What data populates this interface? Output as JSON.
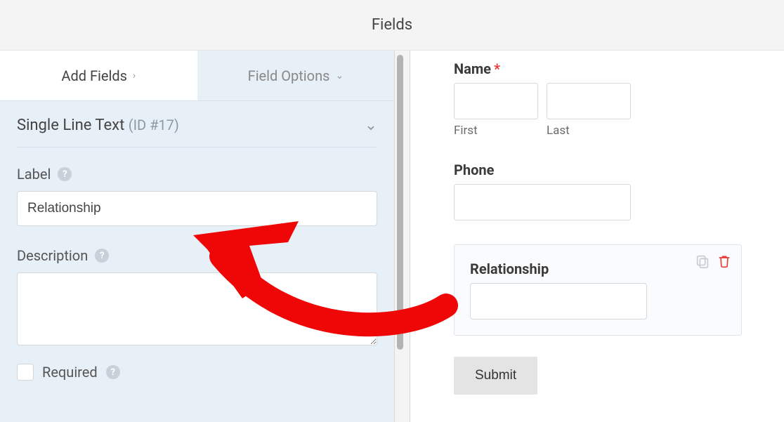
{
  "header": {
    "title": "Fields"
  },
  "tabs": {
    "add_fields": "Add Fields",
    "field_options": "Field Options"
  },
  "editor": {
    "type_label": "Single Line Text",
    "id_label": "(ID #17)",
    "label_label": "Label",
    "label_value": "Relationship",
    "description_label": "Description",
    "description_value": "",
    "required_label": "Required"
  },
  "preview": {
    "name_label": "Name",
    "first_label": "First",
    "last_label": "Last",
    "phone_label": "Phone",
    "relationship_label": "Relationship",
    "submit_label": "Submit"
  },
  "icons": {
    "help": "?",
    "chev_right": "›",
    "chev_down": "⌄"
  }
}
